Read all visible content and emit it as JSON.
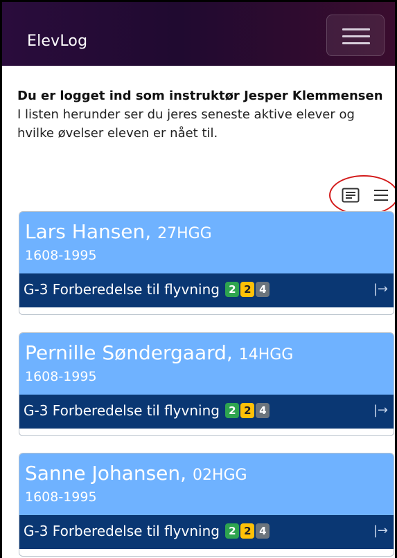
{
  "navbar": {
    "brand": "ElevLog"
  },
  "intro": {
    "logged_in_as": "Du er logget ind som instruktør Jesper Klemmensen",
    "description": "I listen herunder ser du jeres seneste aktive elever og hvilke øvelser eleven er nået til."
  },
  "view_toggle": {
    "icons": [
      "card-view-icon",
      "list-view-icon"
    ],
    "highlight_color": "#d31a1a"
  },
  "students": [
    {
      "name": "Lars Hansen,",
      "code": "27HGG",
      "id": "1608-1995",
      "lesson": "G-3 Forberedelse til flyvning",
      "badges": [
        "2",
        "2",
        "4"
      ]
    },
    {
      "name": "Pernille Søndergaard,",
      "code": "14HGG",
      "id": "1608-1995",
      "lesson": "G-3 Forberedelse til flyvning",
      "badges": [
        "2",
        "2",
        "4"
      ]
    },
    {
      "name": "Sanne Johansen,",
      "code": "02HGG",
      "id": "1608-1995",
      "lesson": "G-3 Forberedelse til flyvning",
      "badges": [
        "2",
        "2",
        "4"
      ]
    }
  ],
  "colors": {
    "card_header": "#6fb2ff",
    "lesson_bar": "#0a3773",
    "badge_green": "#2ea44f",
    "badge_yellow": "#ffc107",
    "badge_gray": "#6c757d"
  }
}
